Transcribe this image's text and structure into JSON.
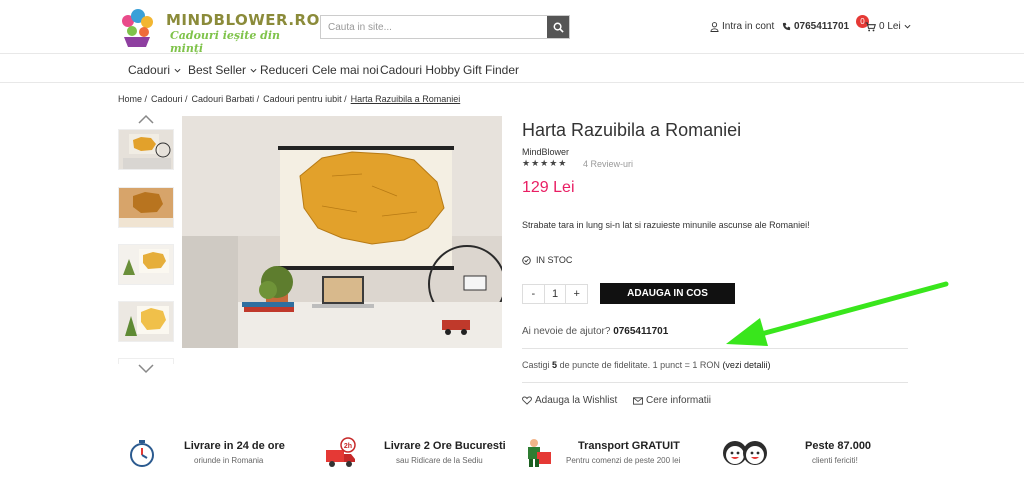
{
  "header": {
    "logo_title": "MINDBLOWER.RO",
    "logo_tagline": "Cadouri ieșite din minți",
    "search_placeholder": "Cauta in site...",
    "login_label": "Intra in cont",
    "phone": "0765411701",
    "cart_count": "0",
    "cart_total": "0 Lei"
  },
  "nav": {
    "items": [
      "Cadouri",
      "Best Seller",
      "Reduceri",
      "Cele mai noi",
      "Cadouri Hobby",
      "Gift Finder"
    ]
  },
  "breadcrumb": [
    "Home /",
    "Cadouri /",
    "Cadouri Barbati /",
    "Cadouri pentru iubit /",
    "Harta Razuibila a Romaniei"
  ],
  "product": {
    "title": "Harta Razuibila a Romaniei",
    "brand": "MindBlower",
    "stars": "★★★★★",
    "rating": 5,
    "reviews": "4 Review-uri",
    "price": "129 Lei",
    "description": "Strabate tara in lung si-n lat si razuieste minunile ascunse ale Romaniei!",
    "stock": "IN STOC",
    "qty_minus": "-",
    "qty_value": "1",
    "qty_plus": "+",
    "add_to_cart": "ADAUGA IN COS",
    "help_text": "Ai nevoie de ajutor?",
    "help_phone": "0765411701",
    "loyalty_pre": "Castigi",
    "loyalty_points": "5",
    "loyalty_mid": "de puncte de fidelitate. 1 punct = 1 RON",
    "loyalty_link": "(vezi detalii)",
    "wishlist": "Adauga la Wishlist",
    "info_request": "Cere informatii"
  },
  "features": [
    {
      "title": "Livrare in 24 de ore",
      "subtitle": "oriunde in Romania"
    },
    {
      "title": "Livrare 2 Ore Bucuresti",
      "subtitle": "sau Ridicare de la Sediu"
    },
    {
      "title": "Transport GRATUIT",
      "subtitle": "Pentru comenzi de peste 200 lei"
    },
    {
      "title": "Peste 87.000",
      "subtitle": "clienti fericiti!"
    }
  ],
  "colors": {
    "price": "#e91e63",
    "button": "#111111",
    "arrow": "#39e61c",
    "logo_title": "#8b8b3a",
    "logo_tagline": "#7fc34a"
  },
  "icons": {
    "search": "search-icon",
    "user": "user-icon",
    "phone": "phone-icon",
    "cart": "cart-icon",
    "check": "check-circle-icon",
    "heart": "heart-icon",
    "mail": "mail-icon"
  }
}
